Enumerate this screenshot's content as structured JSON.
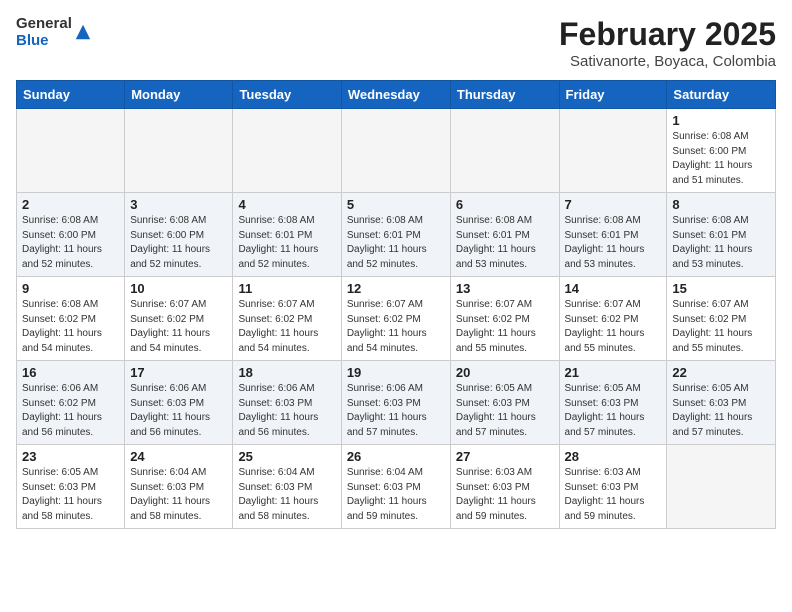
{
  "header": {
    "logo_line1": "General",
    "logo_line2": "Blue",
    "title": "February 2025",
    "subtitle": "Sativanorte, Boyaca, Colombia"
  },
  "weekdays": [
    "Sunday",
    "Monday",
    "Tuesday",
    "Wednesday",
    "Thursday",
    "Friday",
    "Saturday"
  ],
  "weeks": [
    [
      {
        "day": "",
        "info": ""
      },
      {
        "day": "",
        "info": ""
      },
      {
        "day": "",
        "info": ""
      },
      {
        "day": "",
        "info": ""
      },
      {
        "day": "",
        "info": ""
      },
      {
        "day": "",
        "info": ""
      },
      {
        "day": "1",
        "info": "Sunrise: 6:08 AM\nSunset: 6:00 PM\nDaylight: 11 hours\nand 51 minutes."
      }
    ],
    [
      {
        "day": "2",
        "info": "Sunrise: 6:08 AM\nSunset: 6:00 PM\nDaylight: 11 hours\nand 52 minutes."
      },
      {
        "day": "3",
        "info": "Sunrise: 6:08 AM\nSunset: 6:00 PM\nDaylight: 11 hours\nand 52 minutes."
      },
      {
        "day": "4",
        "info": "Sunrise: 6:08 AM\nSunset: 6:01 PM\nDaylight: 11 hours\nand 52 minutes."
      },
      {
        "day": "5",
        "info": "Sunrise: 6:08 AM\nSunset: 6:01 PM\nDaylight: 11 hours\nand 52 minutes."
      },
      {
        "day": "6",
        "info": "Sunrise: 6:08 AM\nSunset: 6:01 PM\nDaylight: 11 hours\nand 53 minutes."
      },
      {
        "day": "7",
        "info": "Sunrise: 6:08 AM\nSunset: 6:01 PM\nDaylight: 11 hours\nand 53 minutes."
      },
      {
        "day": "8",
        "info": "Sunrise: 6:08 AM\nSunset: 6:01 PM\nDaylight: 11 hours\nand 53 minutes."
      }
    ],
    [
      {
        "day": "9",
        "info": "Sunrise: 6:08 AM\nSunset: 6:02 PM\nDaylight: 11 hours\nand 54 minutes."
      },
      {
        "day": "10",
        "info": "Sunrise: 6:07 AM\nSunset: 6:02 PM\nDaylight: 11 hours\nand 54 minutes."
      },
      {
        "day": "11",
        "info": "Sunrise: 6:07 AM\nSunset: 6:02 PM\nDaylight: 11 hours\nand 54 minutes."
      },
      {
        "day": "12",
        "info": "Sunrise: 6:07 AM\nSunset: 6:02 PM\nDaylight: 11 hours\nand 54 minutes."
      },
      {
        "day": "13",
        "info": "Sunrise: 6:07 AM\nSunset: 6:02 PM\nDaylight: 11 hours\nand 55 minutes."
      },
      {
        "day": "14",
        "info": "Sunrise: 6:07 AM\nSunset: 6:02 PM\nDaylight: 11 hours\nand 55 minutes."
      },
      {
        "day": "15",
        "info": "Sunrise: 6:07 AM\nSunset: 6:02 PM\nDaylight: 11 hours\nand 55 minutes."
      }
    ],
    [
      {
        "day": "16",
        "info": "Sunrise: 6:06 AM\nSunset: 6:02 PM\nDaylight: 11 hours\nand 56 minutes."
      },
      {
        "day": "17",
        "info": "Sunrise: 6:06 AM\nSunset: 6:03 PM\nDaylight: 11 hours\nand 56 minutes."
      },
      {
        "day": "18",
        "info": "Sunrise: 6:06 AM\nSunset: 6:03 PM\nDaylight: 11 hours\nand 56 minutes."
      },
      {
        "day": "19",
        "info": "Sunrise: 6:06 AM\nSunset: 6:03 PM\nDaylight: 11 hours\nand 57 minutes."
      },
      {
        "day": "20",
        "info": "Sunrise: 6:05 AM\nSunset: 6:03 PM\nDaylight: 11 hours\nand 57 minutes."
      },
      {
        "day": "21",
        "info": "Sunrise: 6:05 AM\nSunset: 6:03 PM\nDaylight: 11 hours\nand 57 minutes."
      },
      {
        "day": "22",
        "info": "Sunrise: 6:05 AM\nSunset: 6:03 PM\nDaylight: 11 hours\nand 57 minutes."
      }
    ],
    [
      {
        "day": "23",
        "info": "Sunrise: 6:05 AM\nSunset: 6:03 PM\nDaylight: 11 hours\nand 58 minutes."
      },
      {
        "day": "24",
        "info": "Sunrise: 6:04 AM\nSunset: 6:03 PM\nDaylight: 11 hours\nand 58 minutes."
      },
      {
        "day": "25",
        "info": "Sunrise: 6:04 AM\nSunset: 6:03 PM\nDaylight: 11 hours\nand 58 minutes."
      },
      {
        "day": "26",
        "info": "Sunrise: 6:04 AM\nSunset: 6:03 PM\nDaylight: 11 hours\nand 59 minutes."
      },
      {
        "day": "27",
        "info": "Sunrise: 6:03 AM\nSunset: 6:03 PM\nDaylight: 11 hours\nand 59 minutes."
      },
      {
        "day": "28",
        "info": "Sunrise: 6:03 AM\nSunset: 6:03 PM\nDaylight: 11 hours\nand 59 minutes."
      },
      {
        "day": "",
        "info": ""
      }
    ]
  ]
}
